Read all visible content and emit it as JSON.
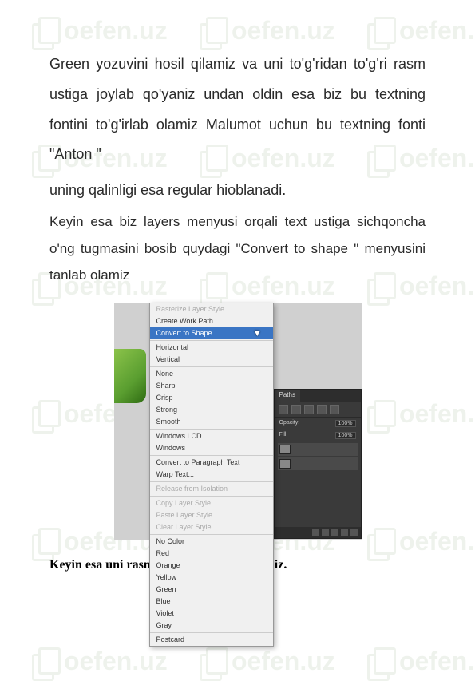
{
  "watermark": {
    "text": "oefen.uz"
  },
  "paragraphs": {
    "p1": "Green yozuvini hosil qilamiz va uni to'g'ridan to'g'ri rasm ustiga joylab qo'yaniz undan oldin esa biz bu textning fontini to'g'irlab olamiz Malumot uchun bu textning fonti \"Anton \"",
    "p2": "uning qalinligi esa regular hioblanadi.",
    "p3": "Keyin esa biz layers menyusi orqali text ustiga sichqoncha o'ng tugmasini bosib quydagi \"Convert  to shape \" menyusini tanlab olamiz"
  },
  "contextMenu": {
    "items": [
      {
        "label": "Rasterize Layer Style",
        "disabled": true
      },
      {
        "label": "Create Work Path",
        "disabled": false
      },
      {
        "label": "Convert to Shape",
        "highlight": true
      },
      {
        "sep": true
      },
      {
        "label": "Horizontal",
        "disabled": false
      },
      {
        "label": "Vertical",
        "disabled": false
      },
      {
        "sep": true
      },
      {
        "label": "None",
        "disabled": false
      },
      {
        "label": "Sharp",
        "disabled": false
      },
      {
        "label": "Crisp",
        "disabled": false
      },
      {
        "label": "Strong",
        "disabled": false
      },
      {
        "label": "Smooth",
        "disabled": false
      },
      {
        "sep": true
      },
      {
        "label": "Windows LCD",
        "disabled": false
      },
      {
        "label": "Windows",
        "disabled": false
      },
      {
        "sep": true
      },
      {
        "label": "Convert to Paragraph Text",
        "disabled": false
      },
      {
        "label": "Warp Text...",
        "disabled": false
      },
      {
        "sep": true
      },
      {
        "label": "Release from Isolation",
        "disabled": true
      },
      {
        "sep": true
      },
      {
        "label": "Copy Layer Style",
        "disabled": true
      },
      {
        "label": "Paste Layer Style",
        "disabled": true
      },
      {
        "label": "Clear Layer Style",
        "disabled": true
      },
      {
        "sep": true
      },
      {
        "label": "No Color",
        "disabled": false
      },
      {
        "label": "Red",
        "disabled": false
      },
      {
        "label": "Orange",
        "disabled": false
      },
      {
        "label": "Yellow",
        "disabled": false
      },
      {
        "label": "Green",
        "disabled": false
      },
      {
        "label": "Blue",
        "disabled": false
      },
      {
        "label": "Violet",
        "disabled": false
      },
      {
        "label": "Gray",
        "disabled": false
      },
      {
        "sep": true
      },
      {
        "label": "Postcard",
        "disabled": false
      }
    ]
  },
  "panel": {
    "tab": "Paths",
    "opacityLabel": "Opacity:",
    "opacityValue": "100%",
    "fillLabel": "Fill:",
    "fillValue": "100%"
  },
  "caption": "Keyin esa uni rasmi ustiga joylab qo'yamiz."
}
